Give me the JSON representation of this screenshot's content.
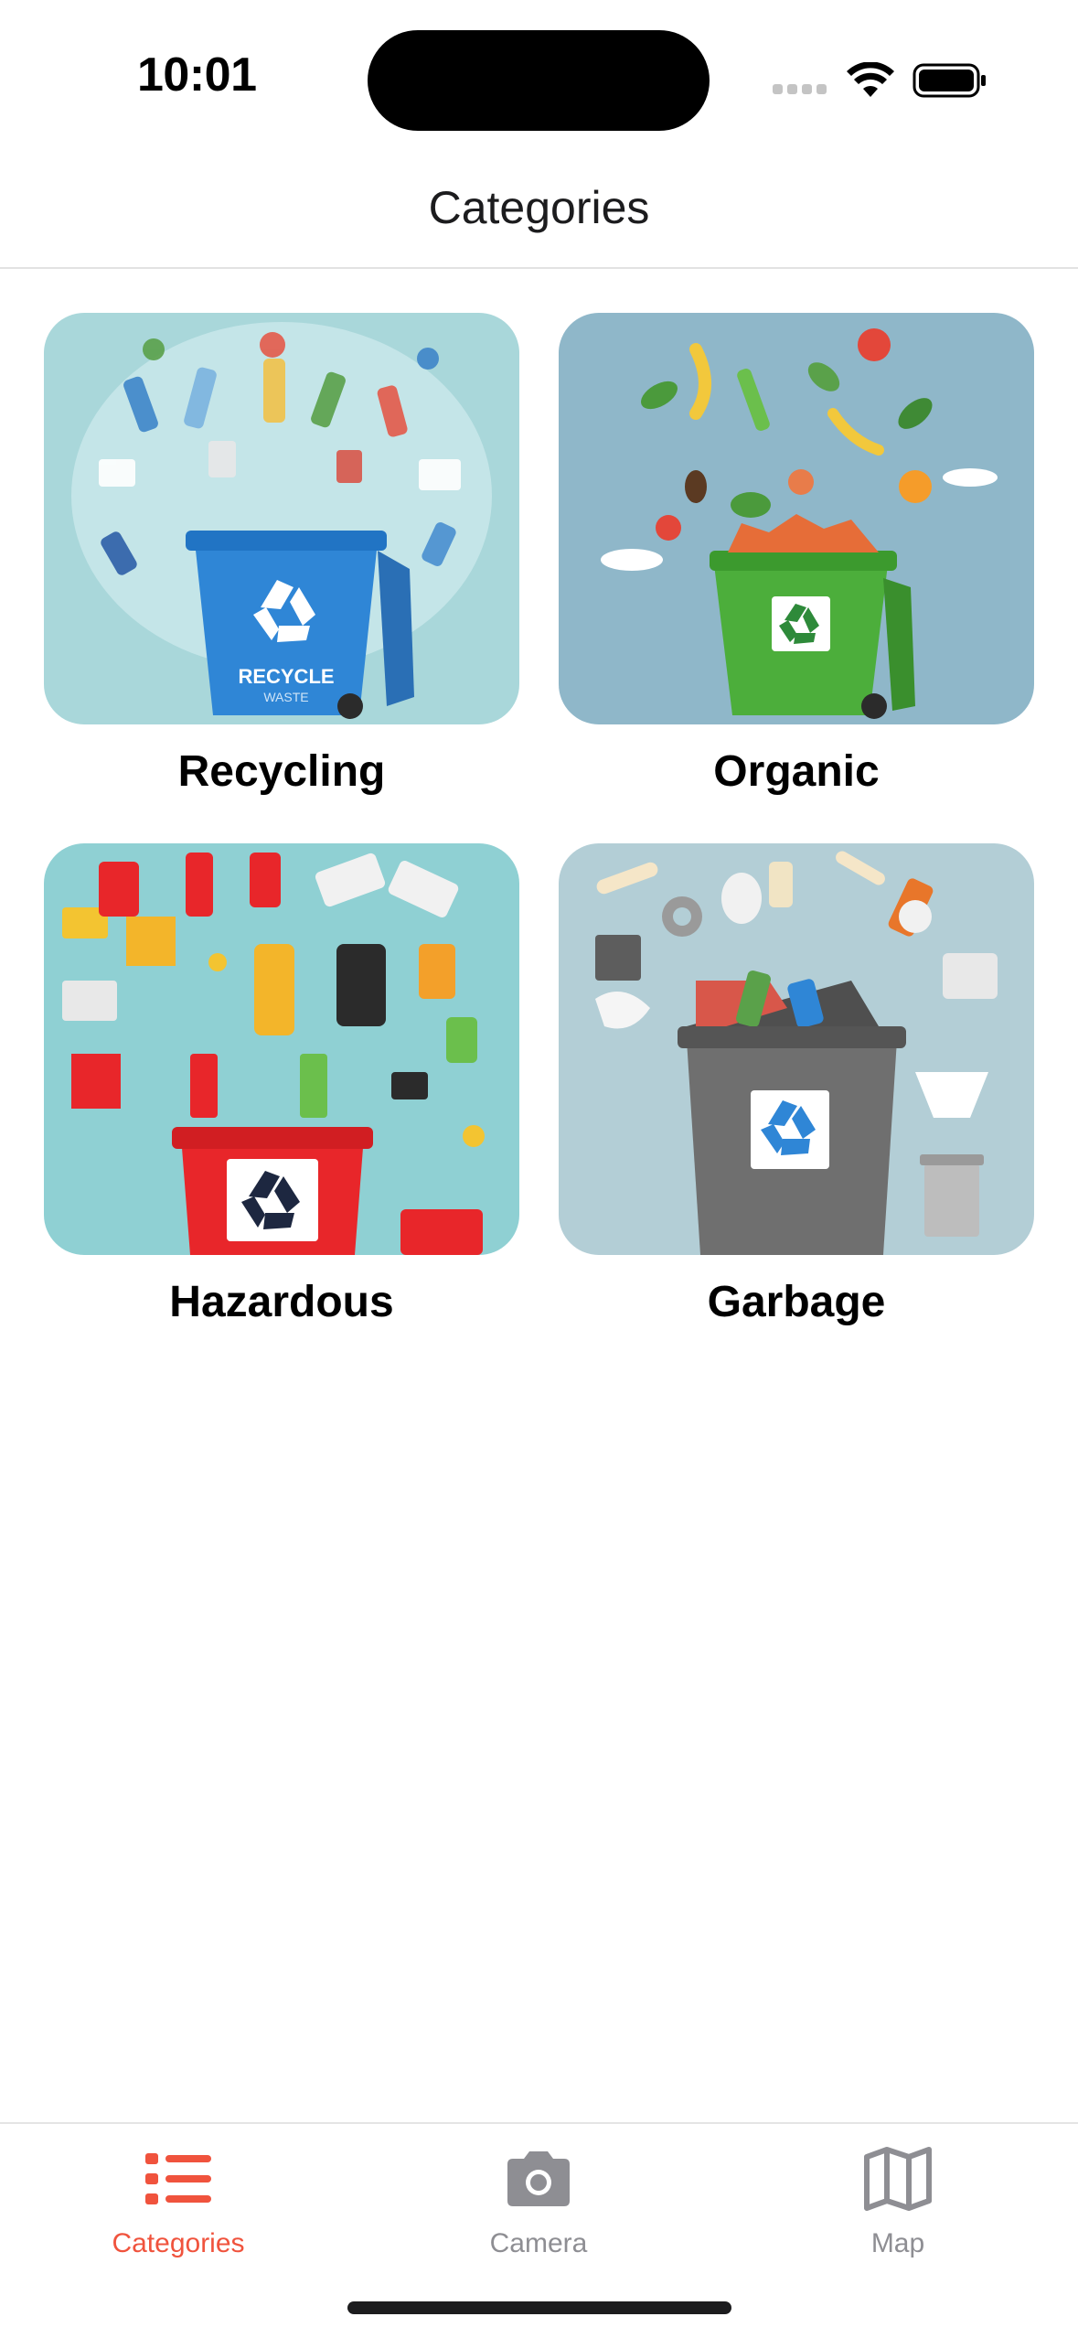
{
  "status_bar": {
    "time": "10:01"
  },
  "header": {
    "title": "Categories"
  },
  "categories": [
    {
      "label": "Recycling",
      "image_icon": "recycle-bin-image",
      "bin_color": "#2f86d6",
      "bin_text": "RECYCLE",
      "bin_subtext": "WASTE"
    },
    {
      "label": "Organic",
      "image_icon": "organic-bin-image",
      "bin_color": "#4cae3b"
    },
    {
      "label": "Hazardous",
      "image_icon": "hazardous-bin-image",
      "bin_color": "#e8262a"
    },
    {
      "label": "Garbage",
      "image_icon": "garbage-bin-image",
      "bin_color": "#6f6f6f"
    }
  ],
  "tabs": [
    {
      "label": "Categories",
      "icon": "list-icon",
      "active": true
    },
    {
      "label": "Camera",
      "icon": "camera-icon",
      "active": false
    },
    {
      "label": "Map",
      "icon": "map-icon",
      "active": false
    }
  ],
  "colors": {
    "accent": "#f0533d",
    "inactive": "#8e8e93"
  }
}
